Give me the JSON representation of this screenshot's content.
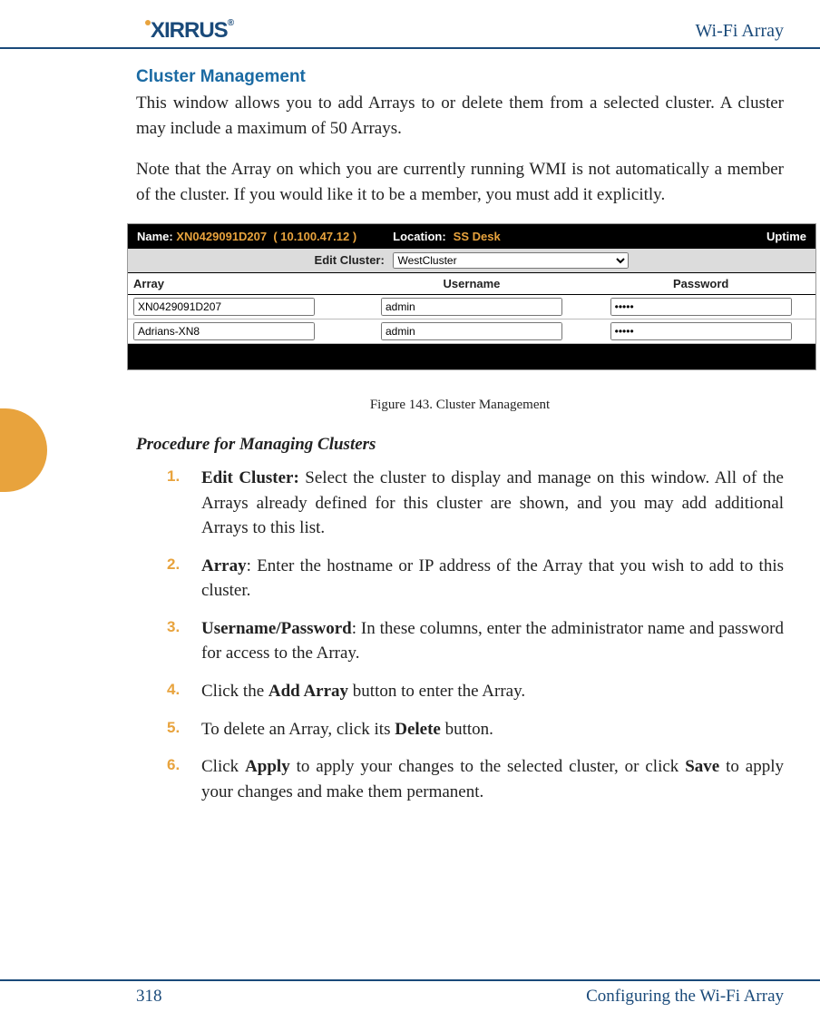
{
  "header": {
    "logo_text": "XIRRUS",
    "doc_title": "Wi-Fi Array"
  },
  "section": {
    "title": "Cluster Management",
    "para1": "This window allows you to add Arrays to or delete them from a selected cluster. A cluster may include a maximum of 50 Arrays.",
    "para2": "Note that the Array on which you are currently running WMI is not automatically a member of the cluster. If you would like it to be a member, you must add it explicitly."
  },
  "screenshot": {
    "name_label": "Name:",
    "name_value": "XN0429091D207",
    "name_ip": "( 10.100.47.12 )",
    "location_label": "Location:",
    "location_value": "SS Desk",
    "uptime_label": "Uptime",
    "edit_cluster_label": "Edit Cluster:",
    "edit_cluster_value": "WestCluster",
    "columns": {
      "array": "Array",
      "username": "Username",
      "password": "Password"
    },
    "rows": [
      {
        "array": "XN0429091D207",
        "username": "admin",
        "password": "•••••"
      },
      {
        "array": "Adrians-XN8",
        "username": "admin",
        "password": "•••••"
      }
    ]
  },
  "figure_caption": "Figure 143. Cluster Management",
  "procedure": {
    "heading": "Procedure for Managing Clusters",
    "items": [
      {
        "n": "1.",
        "bold": "Edit Cluster:",
        "rest": " Select the cluster to display and manage on this window. All of the Arrays already defined for this cluster are shown, and you may add additional Arrays to this list."
      },
      {
        "n": "2.",
        "bold": "Array",
        "rest": ": Enter the hostname or IP address of the Array that you wish to add to this cluster."
      },
      {
        "n": "3.",
        "bold": "Username/Password",
        "rest": ": In these columns, enter the administrator name and password for access to the Array."
      },
      {
        "n": "4.",
        "pre": "Click the ",
        "bold": "Add Array",
        "rest": " button to enter the Array."
      },
      {
        "n": "5.",
        "pre": "To delete an Array, click its ",
        "bold": "Delete",
        "rest": " button."
      },
      {
        "n": "6.",
        "pre": "Click ",
        "bold": "Apply",
        "mid": " to apply your changes to the selected cluster, or click ",
        "bold2": "Save",
        "rest": " to apply your changes and make them permanent."
      }
    ]
  },
  "footer": {
    "page": "318",
    "section": "Configuring the Wi-Fi Array"
  }
}
